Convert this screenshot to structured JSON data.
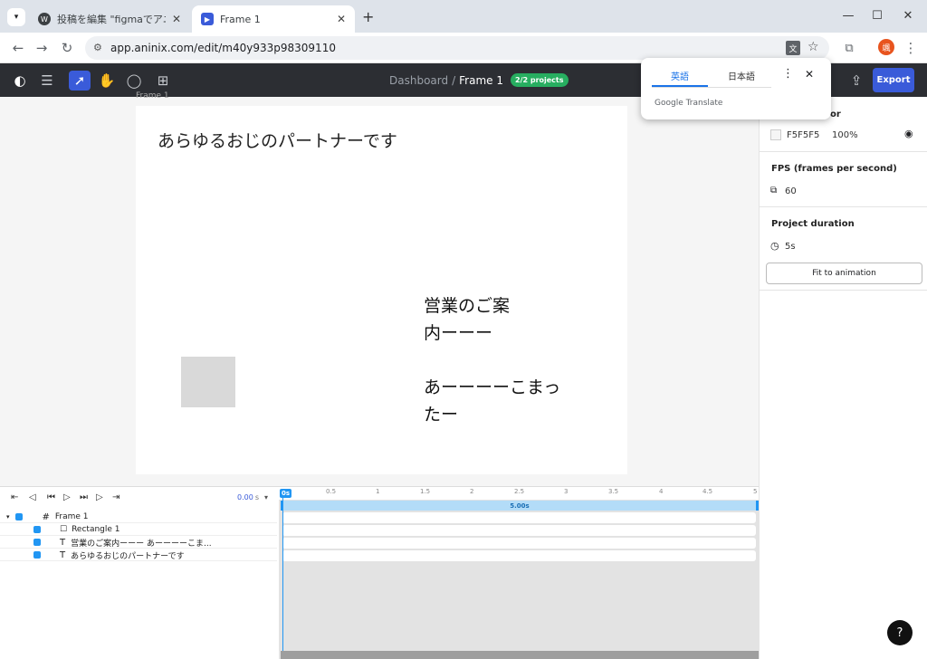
{
  "browser": {
    "tabs": [
      {
        "title": "投稿を編集 \"figmaでアニメーショ"
      },
      {
        "title": "Frame 1"
      }
    ],
    "new_tab": "+",
    "url": "app.aninix.com/edit/m40y933p98309110",
    "profile_initial": "颯"
  },
  "translate_popup": {
    "tab_active": "英語",
    "tab_other": "日本語",
    "brand": "Google Translate"
  },
  "app": {
    "breadcrumb_root": "Dashboard",
    "breadcrumb_sep": "/",
    "breadcrumb_current": "Frame 1",
    "projects_badge": "2/2 projects",
    "export_label": "Export",
    "frame_label": "Frame 1",
    "frame_text_1": "あらゆるおじのパートナーです",
    "frame_text_2_lines": [
      "営業のご案",
      "内ーーー",
      "",
      "あーーーーこまっ",
      "たー"
    ]
  },
  "right_panel": {
    "bg_label_partial": "or",
    "bg_color": "F5F5F5",
    "bg_opacity": "100%",
    "fps_title": "FPS (frames per second)",
    "fps_value": "60",
    "duration_title": "Project duration",
    "duration_value": "5s",
    "fit_button": "Fit to animation"
  },
  "timeline": {
    "time_value": "0.00",
    "time_unit": "s",
    "ticks": [
      "0s",
      "0.5",
      "1",
      "1.5",
      "2",
      "2.5",
      "3",
      "3.5",
      "4",
      "4.5",
      "5"
    ],
    "bar_label": "5.00s",
    "layers": [
      {
        "name": "Frame 1"
      },
      {
        "name": "Rectangle 1"
      },
      {
        "name": "営業のご案内ーーー あーーーーこま..."
      },
      {
        "name": "あらゆるおじのパートナーです"
      }
    ]
  },
  "help_label": "?",
  "colors": {
    "accent": "#3a5bd9",
    "badge": "#27ae60",
    "timeline_bar": "#b3dcf8",
    "layer_blue": "#2196f3"
  }
}
